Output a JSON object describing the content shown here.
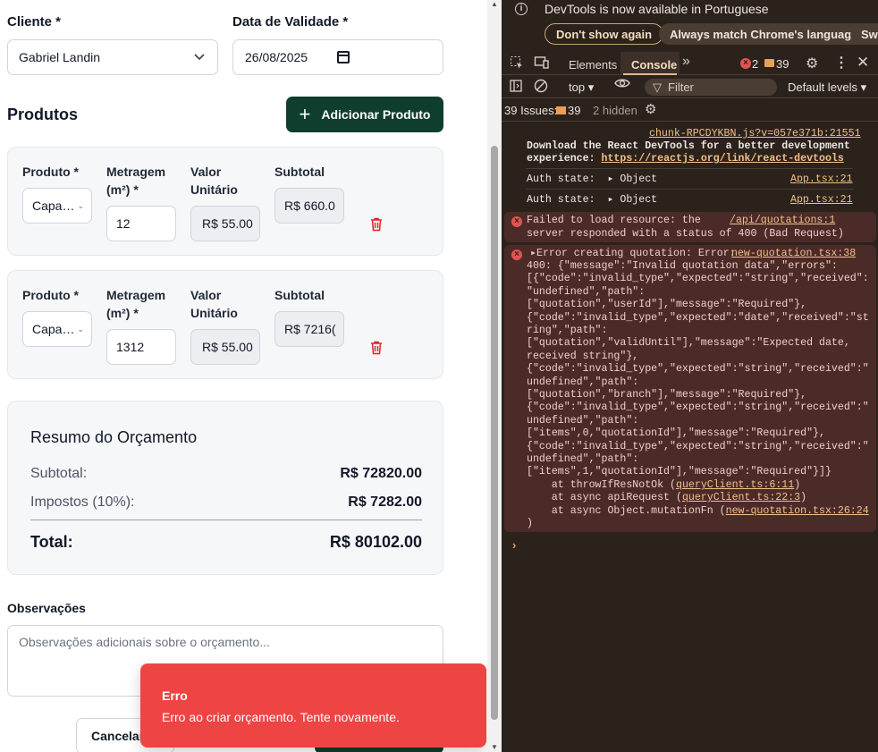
{
  "form": {
    "client_label": "Cliente *",
    "client_value": "Gabriel Landin",
    "validity_label": "Data de Validade *",
    "validity_value": "26/08/2025",
    "products_title": "Produtos",
    "add_product_label": "Adicionar Produto"
  },
  "products": [
    {
      "product_label": "Produto *",
      "product_value": "Capa…",
      "meter_label_1": "Metragem",
      "meter_label_2": "(m²) *",
      "meter_value": "12",
      "unit_label_1": "Valor",
      "unit_label_2": "Unitário",
      "unit_value": "R$ 55.00",
      "subtotal_label": "Subtotal",
      "subtotal_value": "R$ 660.0"
    },
    {
      "product_label": "Produto *",
      "product_value": "Capa…",
      "meter_label_1": "Metragem",
      "meter_label_2": "(m²) *",
      "meter_value": "1312",
      "unit_label_1": "Valor",
      "unit_label_2": "Unitário",
      "unit_value": "R$ 55.00",
      "subtotal_label": "Subtotal",
      "subtotal_value": "R$ 7216("
    }
  ],
  "summary": {
    "title": "Resumo do Orçamento",
    "subtotal_label": "Subtotal:",
    "subtotal_value": "R$ 72820.00",
    "tax_label": "Impostos (10%):",
    "tax_value": "R$ 7282.00",
    "total_label": "Total:",
    "total_value": "R$ 80102.00"
  },
  "notes": {
    "label": "Observações",
    "placeholder": "Observações adicionais sobre o orçamento..."
  },
  "actions": {
    "cancel_label": "Cancelar"
  },
  "toast": {
    "title": "Erro",
    "message": "Erro ao criar orçamento. Tente novamente."
  },
  "devtools": {
    "info_text": "DevTools is now available in Portuguese",
    "dont_show": "Don't show again",
    "match_lang": "Always match Chrome's language",
    "switch": "Swi",
    "tab_elements": "Elements",
    "tab_console": "Console",
    "error_count": "2",
    "message_count": "39",
    "context": "top",
    "filter_placeholder": "Filter",
    "levels": "Default levels",
    "issues_label": "39 Issues:",
    "issues_count": "39",
    "hidden": "2 hidden",
    "logs": {
      "chunk_link": "chunk-RPCDYKBN.js?v=057e371b:21551",
      "react_1": "Download the React DevTools for a better development",
      "react_2": "experience: ",
      "react_link": "https://reactjs.org/link/react-devtools",
      "auth_label": "Auth state:",
      "auth_obj": "Object",
      "app_link": "App.tsx:21",
      "fail_1": "Failed to load resource: the",
      "fail_link": "/api/quotations:1",
      "fail_2": "server responded with a status of 400 (Bad Request)",
      "err_head": "Error creating quotation: Error:",
      "err_link": "new-quotation.tsx:38",
      "err_lines": [
        "400: {\"message\":\"Invalid quotation data\",\"errors\":",
        "[{\"code\":\"invalid_type\",\"expected\":\"string\",\"received\":",
        "\"undefined\",\"path\":",
        "[\"quotation\",\"userId\"],\"message\":\"Required\"},",
        "{\"code\":\"invalid_type\",\"expected\":\"date\",\"received\":\"st",
        "ring\",\"path\":",
        "[\"quotation\",\"validUntil\"],\"message\":\"Expected date,",
        "received string\"},",
        "{\"code\":\"invalid_type\",\"expected\":\"string\",\"received\":\"",
        "undefined\",\"path\":",
        "[\"quotation\",\"branch\"],\"message\":\"Required\"},",
        "{\"code\":\"invalid_type\",\"expected\":\"string\",\"received\":\"",
        "undefined\",\"path\":",
        "[\"items\",0,\"quotationId\"],\"message\":\"Required\"},",
        "{\"code\":\"invalid_type\",\"expected\":\"string\",\"received\":\"",
        "undefined\",\"path\":",
        "[\"items\",1,\"quotationId\"],\"message\":\"Required\"}]}"
      ],
      "stack_1a": "    at throwIfResNotOk (",
      "stack_1l": "queryClient.ts:6:11",
      "stack_2a": "    at async apiRequest (",
      "stack_2l": "queryClient.ts:22:3",
      "stack_3a": "    at async Object.mutationFn (",
      "stack_3l": "new-quotation.tsx:26:24",
      "close_paren": ")",
      "prompt": "›"
    }
  }
}
